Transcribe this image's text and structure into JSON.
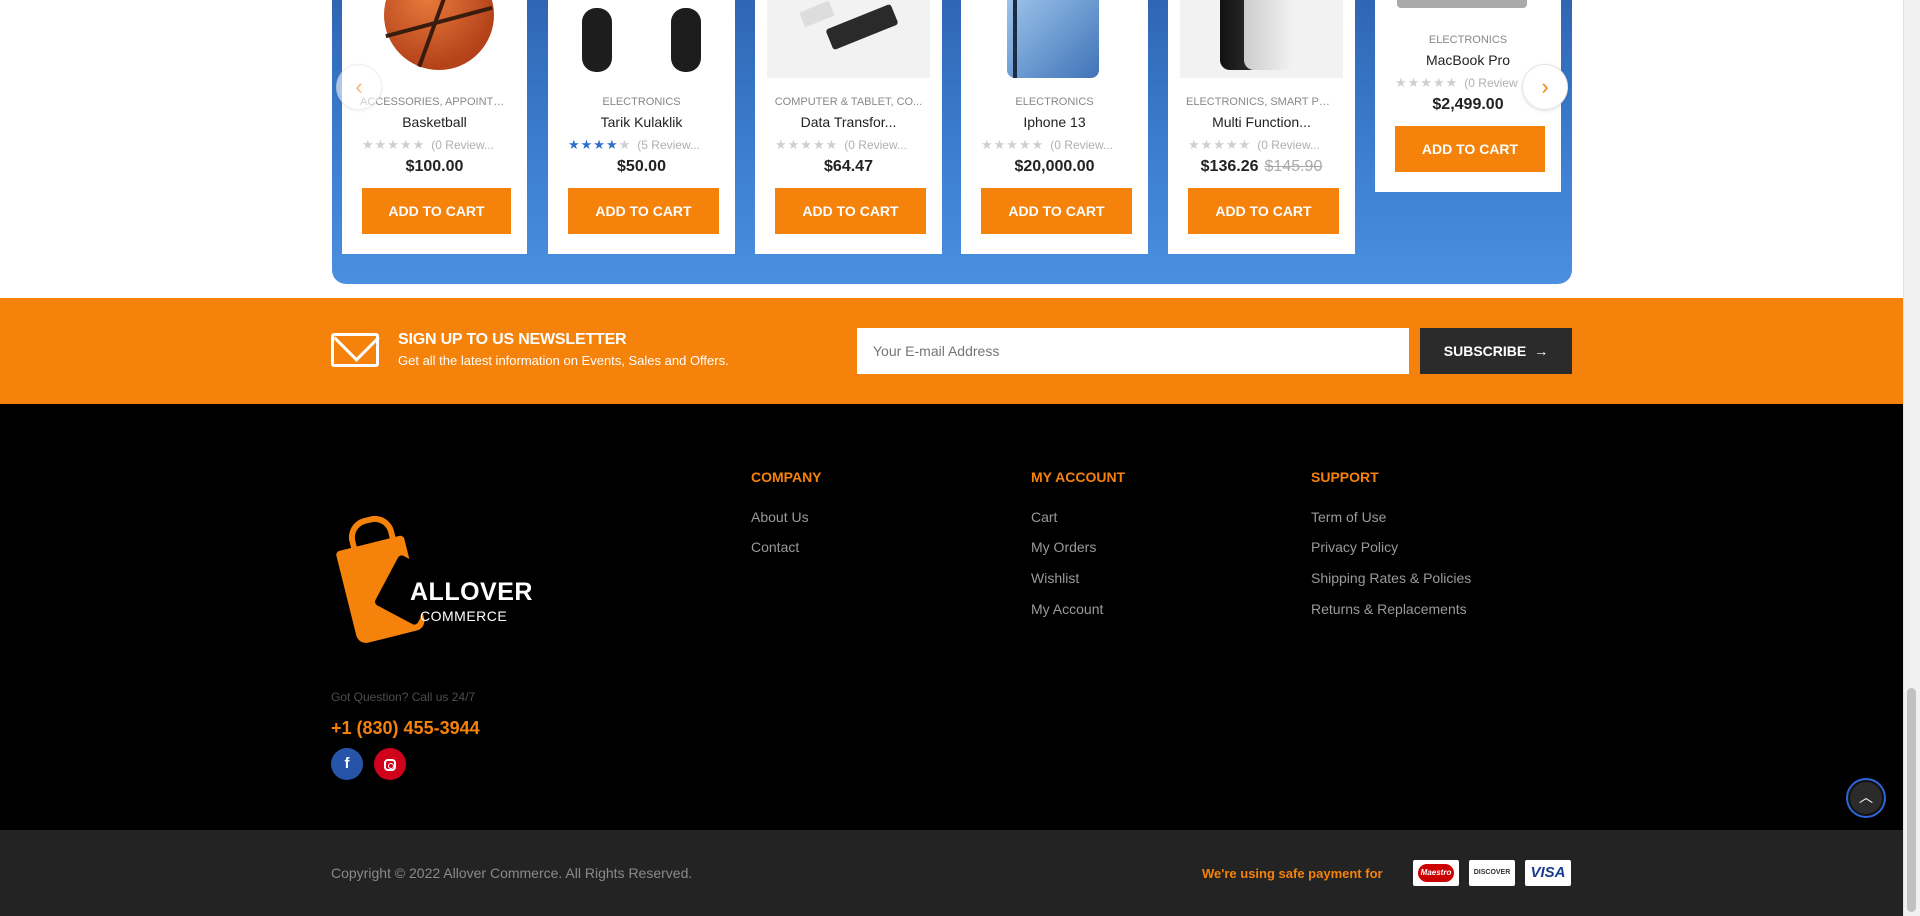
{
  "carousel": {
    "products": [
      {
        "category": "ACCESSORIES, APPOINTME...",
        "name": "Basketball",
        "stars": 0,
        "reviews": "(0 Review...",
        "price": "$100.00",
        "old_price": "",
        "cart_label": "ADD TO CART"
      },
      {
        "category": "ELECTRONICS",
        "name": "Tarik Kulaklik",
        "stars": 3.5,
        "reviews": "(5 Review...",
        "price": "$50.00",
        "old_price": "",
        "cart_label": "ADD TO CART"
      },
      {
        "category": "COMPUTER & TABLET, CO...",
        "name": "Data Transfor...",
        "stars": 0,
        "reviews": "(0 Review...",
        "price": "$64.47",
        "old_price": "",
        "cart_label": "ADD TO CART"
      },
      {
        "category": "ELECTRONICS",
        "name": "Iphone 13",
        "stars": 0,
        "reviews": "(0 Review...",
        "price": "$20,000.00",
        "old_price": "",
        "cart_label": "ADD TO CART"
      },
      {
        "category": "ELECTRONICS, SMART PHO...",
        "name": "Multi Function...",
        "stars": 0,
        "reviews": "(0 Review...",
        "price": "$136.26",
        "old_price": "$145.90",
        "cart_label": "ADD TO CART"
      },
      {
        "category": "ELECTRONICS",
        "name": "MacBook Pro",
        "stars": 0,
        "reviews": "(0 Review",
        "price": "$2,499.00",
        "old_price": "",
        "cart_label": "ADD TO CART"
      }
    ],
    "prev_icon": "chevron-left-icon",
    "next_icon": "chevron-right-icon"
  },
  "newsletter": {
    "title": "SIGN UP TO US NEWSLETTER",
    "subtitle": "Get all the latest information on Events, Sales and Offers.",
    "input_placeholder": "Your E-mail Address",
    "button_label": "SUBSCRIBE",
    "icon": "envelope-icon"
  },
  "footer": {
    "logo_name": "ALLOVER",
    "logo_sub": "COMMERCE",
    "question": "Got Question? Call us 24/7",
    "phone": "+1 (830) 455-3944",
    "columns": [
      {
        "title": "COMPANY",
        "links": [
          "About Us",
          "Contact"
        ]
      },
      {
        "title": "MY ACCOUNT",
        "links": [
          "Cart",
          "My Orders",
          "Wishlist",
          "My Account"
        ]
      },
      {
        "title": "SUPPORT",
        "links": [
          "Term of Use",
          "Privacy Policy",
          "Shipping Rates & Policies",
          "Returns & Replacements"
        ]
      }
    ],
    "social": [
      "facebook-icon",
      "instagram-icon"
    ]
  },
  "bottom": {
    "copyright": "Copyright © 2022 Allover Commerce. All Rights Reserved.",
    "safe_payment": "We're using safe payment for",
    "payments": [
      "Maestro",
      "DISCOVER",
      "VISA"
    ]
  },
  "colors": {
    "accent": "#f5820b",
    "band_blue": "#3d7ed1",
    "footer_bg": "#000000",
    "bottom_bg": "#232323"
  }
}
